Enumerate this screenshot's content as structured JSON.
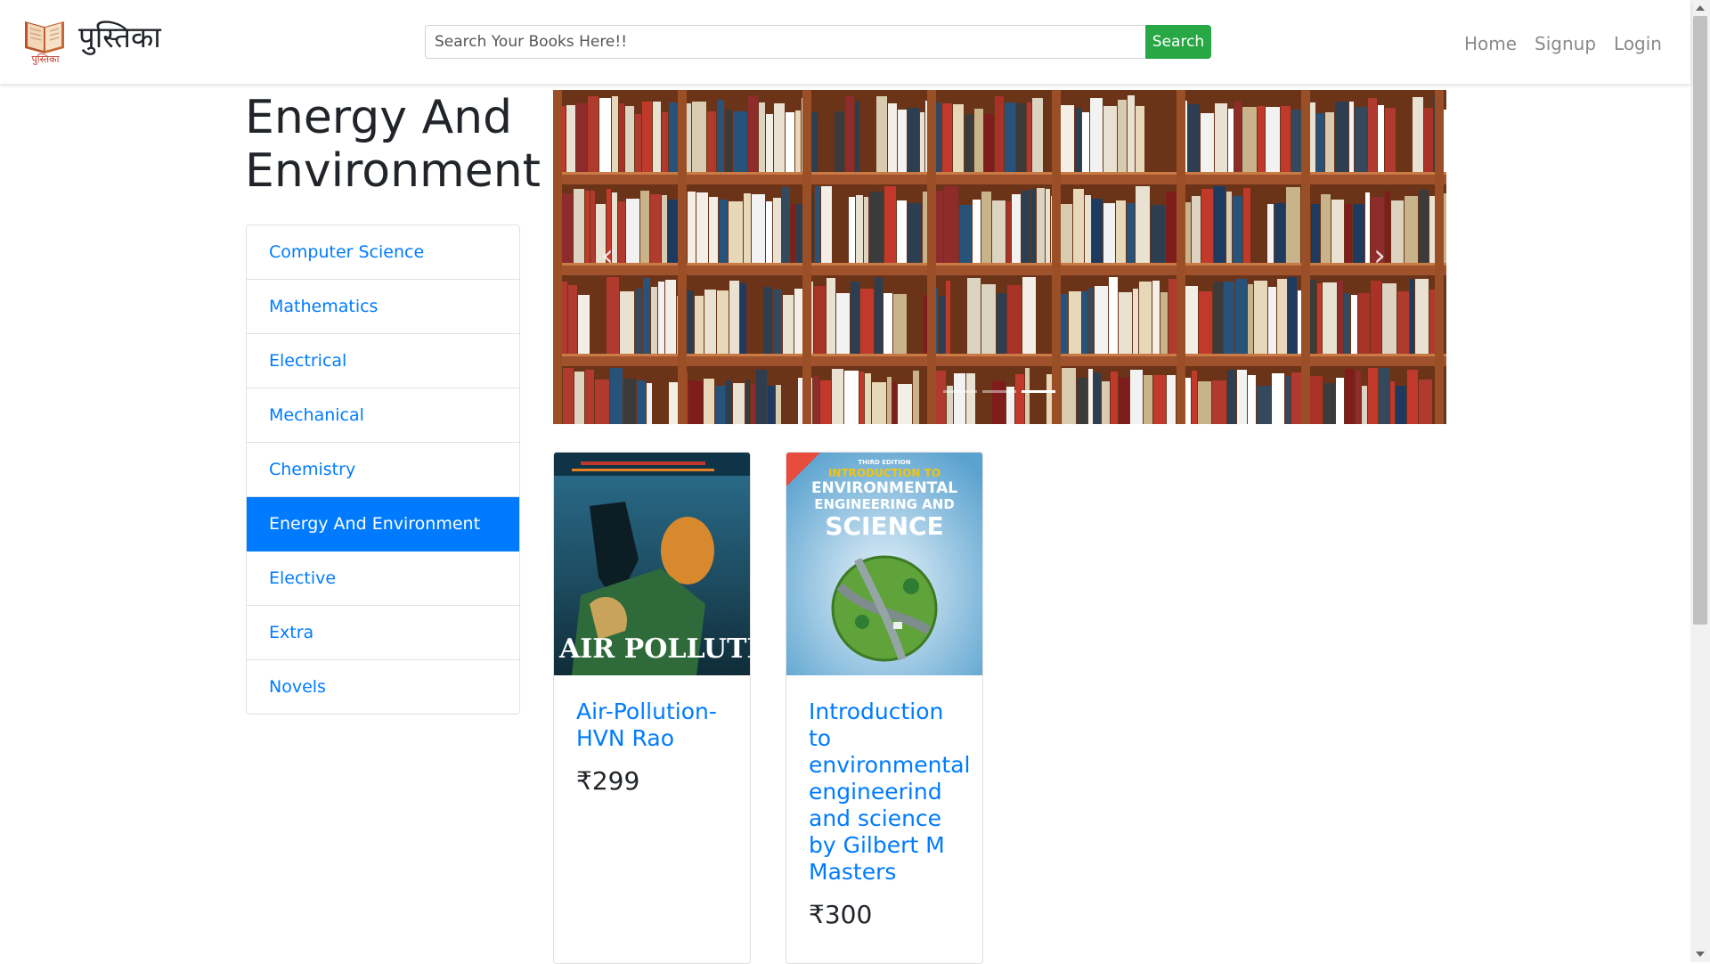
{
  "navbar": {
    "brand_name": "पुस्तिका",
    "logo_caption": "पुस्तिका",
    "search_placeholder": "Search Your Books Here!!",
    "search_button": "Search",
    "links": [
      "Home",
      "Signup",
      "Login"
    ]
  },
  "sidebar": {
    "heading": "Energy And Environment",
    "categories": [
      {
        "label": "Computer Science",
        "active": false
      },
      {
        "label": "Mathematics",
        "active": false
      },
      {
        "label": "Electrical",
        "active": false
      },
      {
        "label": "Mechanical",
        "active": false
      },
      {
        "label": "Chemistry",
        "active": false
      },
      {
        "label": "Energy And Environment",
        "active": true
      },
      {
        "label": "Elective",
        "active": false
      },
      {
        "label": "Extra",
        "active": false
      },
      {
        "label": "Novels",
        "active": false
      }
    ]
  },
  "carousel": {
    "prev_icon": "‹",
    "next_icon": "›",
    "slide_count": 3,
    "active_slide": 3
  },
  "books": [
    {
      "title": "Air-Pollution-HVN Rao",
      "price": "₹299",
      "cover_text": "AIR POLLUTION"
    },
    {
      "title": "Introduction to environmental engineerind and science by Gilbert M Masters",
      "price": "₹300",
      "cover_text": [
        "THIRD EDITION",
        "INTRODUCTION TO",
        "ENVIRONMENTAL",
        "ENGINEERING AND",
        "SCIENCE"
      ]
    }
  ],
  "colors": {
    "accent": "#007bff",
    "search_button": "#28a745",
    "nav_link": "#8a8a8a"
  }
}
